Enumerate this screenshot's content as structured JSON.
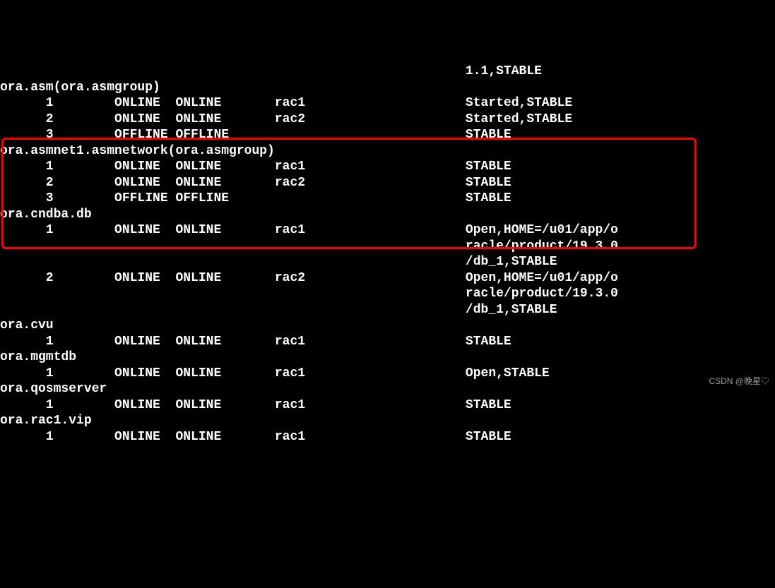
{
  "rows": [
    {
      "c0": "",
      "c1": "",
      "c2": "",
      "c3": "",
      "c4": "",
      "c5": "1.1,STABLE"
    },
    {
      "c0": "ora.asm(ora.asmgroup)",
      "c1": "",
      "c2": "",
      "c3": "",
      "c4": "",
      "c5": ""
    },
    {
      "c0": "",
      "c1": "1",
      "c2": "ONLINE",
      "c3": "ONLINE",
      "c4": "rac1",
      "c5": "Started,STABLE"
    },
    {
      "c0": "",
      "c1": "2",
      "c2": "ONLINE",
      "c3": "ONLINE",
      "c4": "rac2",
      "c5": "Started,STABLE"
    },
    {
      "c0": "",
      "c1": "3",
      "c2": "OFFLINE",
      "c3": "OFFLINE",
      "c4": "",
      "c5": "STABLE"
    },
    {
      "c0": "ora.asmnet1.asmnetwork(ora.asmgroup)",
      "c1": "",
      "c2": "",
      "c3": "",
      "c4": "",
      "c5": ""
    },
    {
      "c0": "",
      "c1": "1",
      "c2": "ONLINE",
      "c3": "ONLINE",
      "c4": "rac1",
      "c5": "STABLE"
    },
    {
      "c0": "",
      "c1": "2",
      "c2": "ONLINE",
      "c3": "ONLINE",
      "c4": "rac2",
      "c5": "STABLE"
    },
    {
      "c0": "",
      "c1": "3",
      "c2": "OFFLINE",
      "c3": "OFFLINE",
      "c4": "",
      "c5": "STABLE"
    },
    {
      "c0": "ora.cndba.db",
      "c1": "",
      "c2": "",
      "c3": "",
      "c4": "",
      "c5": ""
    },
    {
      "c0": "",
      "c1": "1",
      "c2": "ONLINE",
      "c3": "ONLINE",
      "c4": "rac1",
      "c5": "Open,HOME=/u01/app/o"
    },
    {
      "c0": "",
      "c1": "",
      "c2": "",
      "c3": "",
      "c4": "",
      "c5": "racle/product/19.3.0"
    },
    {
      "c0": "",
      "c1": "",
      "c2": "",
      "c3": "",
      "c4": "",
      "c5": "/db_1,STABLE"
    },
    {
      "c0": "",
      "c1": "2",
      "c2": "ONLINE",
      "c3": "ONLINE",
      "c4": "rac2",
      "c5": "Open,HOME=/u01/app/o"
    },
    {
      "c0": "",
      "c1": "",
      "c2": "",
      "c3": "",
      "c4": "",
      "c5": "racle/product/19.3.0"
    },
    {
      "c0": "",
      "c1": "",
      "c2": "",
      "c3": "",
      "c4": "",
      "c5": "/db_1,STABLE"
    },
    {
      "c0": "ora.cvu",
      "c1": "",
      "c2": "",
      "c3": "",
      "c4": "",
      "c5": ""
    },
    {
      "c0": "",
      "c1": "1",
      "c2": "ONLINE",
      "c3": "ONLINE",
      "c4": "rac1",
      "c5": "STABLE"
    },
    {
      "c0": "ora.mgmtdb",
      "c1": "",
      "c2": "",
      "c3": "",
      "c4": "",
      "c5": ""
    },
    {
      "c0": "",
      "c1": "1",
      "c2": "ONLINE",
      "c3": "ONLINE",
      "c4": "rac1",
      "c5": "Open,STABLE"
    },
    {
      "c0": "ora.qosmserver",
      "c1": "",
      "c2": "",
      "c3": "",
      "c4": "",
      "c5": ""
    },
    {
      "c0": "",
      "c1": "1",
      "c2": "ONLINE",
      "c3": "ONLINE",
      "c4": "rac1",
      "c5": "STABLE"
    },
    {
      "c0": "ora.rac1.vip",
      "c1": "",
      "c2": "",
      "c3": "",
      "c4": "",
      "c5": ""
    },
    {
      "c0": "",
      "c1": "1",
      "c2": "ONLINE",
      "c3": "ONLINE",
      "c4": "rac1",
      "c5": "STABLE"
    }
  ],
  "cols": {
    "idx": 6,
    "target": 15,
    "state": 23,
    "server": 36,
    "details": 61
  },
  "watermark": "CSDN @晚星♡"
}
